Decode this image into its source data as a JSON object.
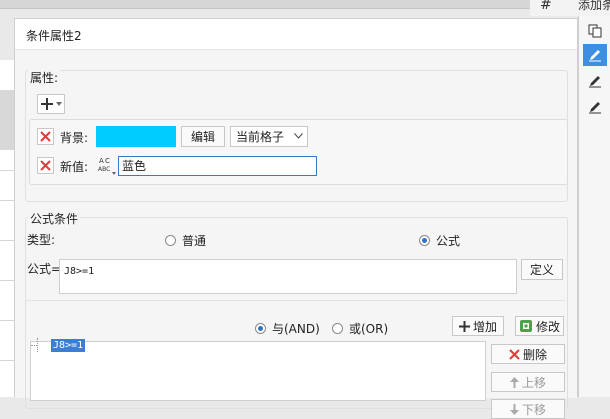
{
  "background": {
    "add_label": "添加条",
    "accent": "#3d8fe3"
  },
  "dialog": {
    "title": "条件属性2",
    "attributes": {
      "legend": "属性:",
      "background_label": "背景:",
      "background_color": "#00ccff",
      "edit_label": "编辑",
      "scope_value": "当前格子",
      "new_value_label": "新值:",
      "new_value": "蓝色"
    },
    "formula_condition": {
      "legend": "公式条件",
      "type_label": "类型:",
      "type_options": [
        "普通",
        "公式"
      ],
      "type_selected": "公式",
      "formula_label": "公式=",
      "formula_value": "J8>=1",
      "define_label": "定义",
      "and_label": "与(AND)",
      "or_label": "或(OR)",
      "logic_selected": "与(AND)",
      "add_label": "增加",
      "modify_label": "修改",
      "conditions": [
        "J8>=1"
      ],
      "delete_label": "删除",
      "move_up_label": "上移",
      "move_down_label": "下移"
    }
  }
}
